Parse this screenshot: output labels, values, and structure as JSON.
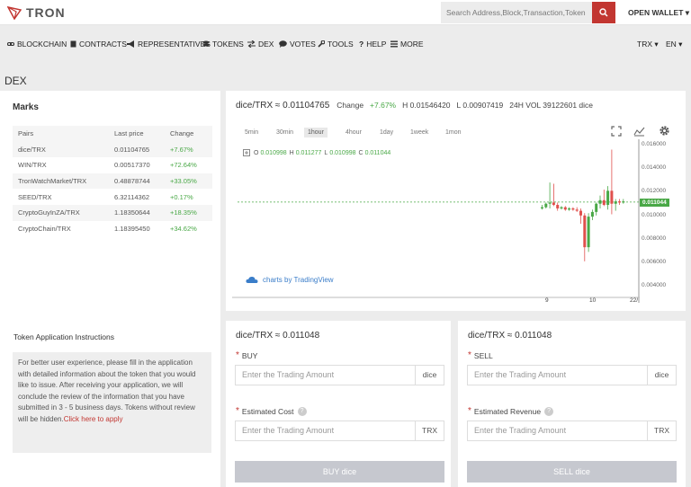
{
  "header": {
    "logo_text": "TRON",
    "search_placeholder": "Search Address,Block,Transaction,Token",
    "open_wallet": "OPEN WALLET ▾"
  },
  "nav": {
    "items": [
      {
        "label": "BLOCKCHAIN",
        "icon": "link-icon"
      },
      {
        "label": "CONTRACTS",
        "icon": "document-icon"
      },
      {
        "label": "REPRESENTATIVES",
        "icon": "megaphone-icon"
      },
      {
        "label": "TOKENS",
        "icon": "coins-icon"
      },
      {
        "label": "DEX",
        "icon": "exchange-icon"
      },
      {
        "label": "VOTES",
        "icon": "chat-icon"
      },
      {
        "label": "TOOLS",
        "icon": "wrench-icon"
      },
      {
        "label": "HELP",
        "icon": "question-icon"
      },
      {
        "label": "MORE",
        "icon": "list-icon"
      }
    ],
    "currency": "TRX ▾",
    "language": "EN ▾"
  },
  "page_title": "DEX",
  "marks": {
    "title": "Marks",
    "headers": [
      "Pairs",
      "Last price",
      "Change"
    ],
    "rows": [
      {
        "pair": "dice/TRX",
        "price": "0.01104765",
        "change": "+7.67%"
      },
      {
        "pair": "WIN/TRX",
        "price": "0.00517370",
        "change": "+72.64%"
      },
      {
        "pair": "TronWatchMarket/TRX",
        "price": "0.48878744",
        "change": "+33.05%"
      },
      {
        "pair": "SEED/TRX",
        "price": "6.32114362",
        "change": "+0.17%"
      },
      {
        "pair": "CryptoGuyInZA/TRX",
        "price": "1.18350644",
        "change": "+18.35%"
      },
      {
        "pair": "CryptoChain/TRX",
        "price": "1.18395450",
        "change": "+34.62%"
      }
    ]
  },
  "instructions": {
    "title": "Token Application Instructions",
    "body": "For better user experience, please fill in the application with detailed information about the token that you would like to issue. After receiving your application, we will conclude the review of the information that you have submitted in 3 - 5 business days. Tokens without review will be hidden.",
    "link": "Click here to apply"
  },
  "chart": {
    "pair": "dice/TRX ≈ 0.01104765",
    "change_label": "Change",
    "change_value": "+7.67%",
    "high": "H  0.01546420",
    "low": "L  0.00907419",
    "vol": "24H VOL  39122601 dice",
    "timeframes": [
      "5min",
      "30min",
      "1hour",
      "4hour",
      "1day",
      "1week",
      "1mon"
    ],
    "active_timeframe": 2,
    "ohlc": {
      "o": "0.010998",
      "h": "0.011277",
      "l": "0.010998",
      "c": "0.011044"
    },
    "y_ticks": [
      "0.016000",
      "0.014000",
      "0.012000",
      "0.010000",
      "0.008000",
      "0.006000",
      "0.004000"
    ],
    "last_tag": "0.011044",
    "x_ticks": [
      "9",
      "10",
      "22/"
    ],
    "brand": "charts by TradingView"
  },
  "chart_data": {
    "type": "candlestick",
    "y_ticks": [
      0.016,
      0.014,
      0.012,
      0.01,
      0.008,
      0.006,
      0.004
    ],
    "x_ticks": [
      "9",
      "10",
      "22/"
    ],
    "last_value": 0.011044,
    "candles": [
      {
        "o": 0.0105,
        "h": 0.0108,
        "l": 0.0104,
        "c": 0.0106
      },
      {
        "o": 0.0106,
        "h": 0.011,
        "l": 0.0105,
        "c": 0.0109
      },
      {
        "o": 0.0109,
        "h": 0.0127,
        "l": 0.0105,
        "c": 0.011
      },
      {
        "o": 0.011,
        "h": 0.0126,
        "l": 0.0107,
        "c": 0.0108
      },
      {
        "o": 0.0108,
        "h": 0.011,
        "l": 0.0103,
        "c": 0.0105
      },
      {
        "o": 0.0105,
        "h": 0.0107,
        "l": 0.0104,
        "c": 0.0106
      },
      {
        "o": 0.0106,
        "h": 0.0107,
        "l": 0.0103,
        "c": 0.0104
      },
      {
        "o": 0.0104,
        "h": 0.0106,
        "l": 0.0103,
        "c": 0.0105
      },
      {
        "o": 0.0105,
        "h": 0.0106,
        "l": 0.0103,
        "c": 0.0104
      },
      {
        "o": 0.0104,
        "h": 0.0106,
        "l": 0.0102,
        "c": 0.0103
      },
      {
        "o": 0.0103,
        "h": 0.0105,
        "l": 0.0092,
        "c": 0.0099
      },
      {
        "o": 0.0099,
        "h": 0.0101,
        "l": 0.006,
        "c": 0.0072
      },
      {
        "o": 0.0072,
        "h": 0.0101,
        "l": 0.0068,
        "c": 0.0098
      },
      {
        "o": 0.0098,
        "h": 0.0104,
        "l": 0.0095,
        "c": 0.0102
      },
      {
        "o": 0.0102,
        "h": 0.011,
        "l": 0.0099,
        "c": 0.0109
      },
      {
        "o": 0.0109,
        "h": 0.0116,
        "l": 0.0105,
        "c": 0.0112
      },
      {
        "o": 0.0112,
        "h": 0.0121,
        "l": 0.0107,
        "c": 0.0108
      },
      {
        "o": 0.0108,
        "h": 0.0124,
        "l": 0.0104,
        "c": 0.012
      },
      {
        "o": 0.012,
        "h": 0.0155,
        "l": 0.01,
        "c": 0.0109
      },
      {
        "o": 0.0109,
        "h": 0.0113,
        "l": 0.0103,
        "c": 0.0111
      },
      {
        "o": 0.0111,
        "h": 0.0113,
        "l": 0.0108,
        "c": 0.011
      },
      {
        "o": 0.011,
        "h": 0.0113,
        "l": 0.0109,
        "c": 0.0111
      }
    ]
  },
  "buy": {
    "title": "dice/TRX ≈ 0.011048",
    "label": "BUY",
    "amount_placeholder": "Enter the Trading Amount",
    "amount_unit": "dice",
    "cost_label": "Estimated Cost",
    "cost_placeholder": "Enter the Trading Amount",
    "cost_unit": "TRX",
    "button": "BUY dice"
  },
  "sell": {
    "title": "dice/TRX ≈ 0.011048",
    "label": "SELL",
    "amount_placeholder": "Enter the Trading Amount",
    "amount_unit": "dice",
    "revenue_label": "Estimated Revenue",
    "revenue_placeholder": "Enter the Trading Amount",
    "revenue_unit": "TRX",
    "button": "SELL dice"
  },
  "colors": {
    "brand_red": "#c23631",
    "up_green": "#49a846",
    "down_red": "#e0504c",
    "link_blue": "#3a7dc9"
  }
}
